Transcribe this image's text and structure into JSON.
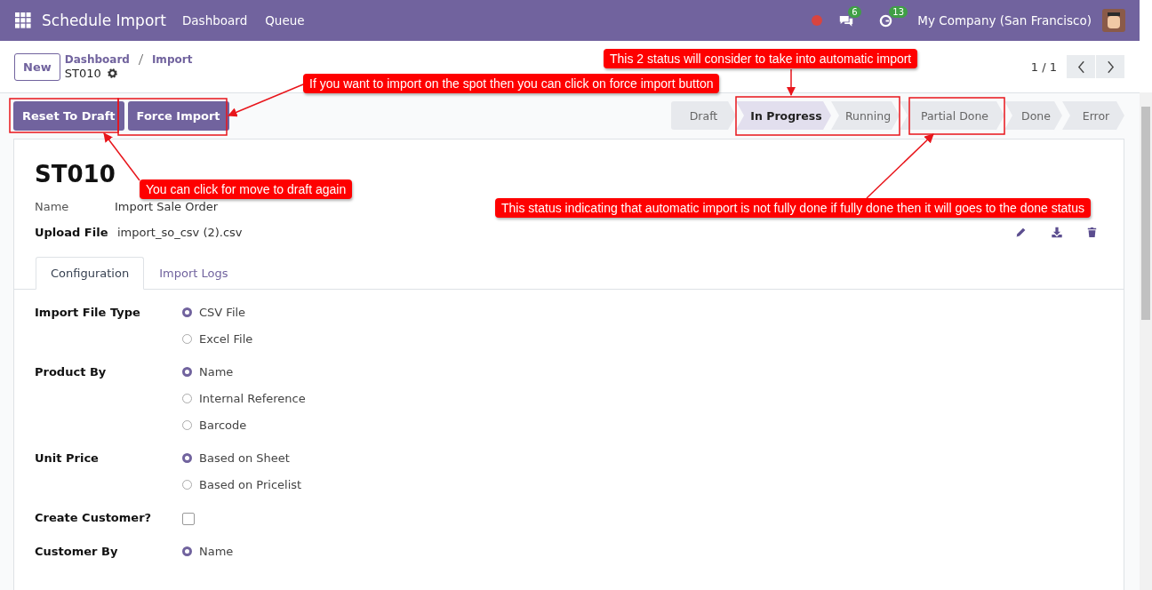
{
  "navbar": {
    "app_name": "Schedule Import",
    "menu": [
      "Dashboard",
      "Queue"
    ],
    "chat_count": "6",
    "activity_count": "13",
    "company": "My Company (San Francisco)"
  },
  "control_panel": {
    "new_button": "New",
    "breadcrumbs": [
      "Dashboard",
      "Import"
    ],
    "record": "ST010",
    "pager": "1 / 1"
  },
  "actions": [
    "Reset To Draft",
    "Force Import"
  ],
  "statusbar": [
    {
      "label": "Draft",
      "selected": false
    },
    {
      "label": "In Progress",
      "selected": true
    },
    {
      "label": "Running",
      "selected": false
    },
    {
      "label": "Partial Done",
      "selected": false
    },
    {
      "label": "Done",
      "selected": false
    },
    {
      "label": "Error",
      "selected": false
    }
  ],
  "form": {
    "title": "ST010",
    "name_label": "Name",
    "name_value": "Import Sale Order",
    "file_label": "Upload File",
    "file_value": "import_so_csv (2).csv",
    "tabs": [
      {
        "label": "Configuration",
        "selected": true
      },
      {
        "label": "Import Logs",
        "selected": false
      }
    ],
    "fields": [
      {
        "label": "Import File Type",
        "kind": "radio",
        "options": [
          {
            "label": "CSV File",
            "selected": true
          },
          {
            "label": "Excel File",
            "selected": false
          }
        ]
      },
      {
        "label": "Product By",
        "kind": "radio",
        "options": [
          {
            "label": "Name",
            "selected": true
          },
          {
            "label": "Internal Reference",
            "selected": false
          },
          {
            "label": "Barcode",
            "selected": false
          }
        ]
      },
      {
        "label": "Unit Price",
        "kind": "radio",
        "options": [
          {
            "label": "Based on Sheet",
            "selected": true
          },
          {
            "label": "Based on Pricelist",
            "selected": false
          }
        ]
      },
      {
        "label": "Create Customer?",
        "kind": "checkbox",
        "checked": false
      },
      {
        "label": "Customer By",
        "kind": "radio",
        "options": [
          {
            "label": "Name",
            "selected": true
          }
        ]
      }
    ]
  },
  "annotations": [
    {
      "text": "If you want to import on the spot then you can click on force import button"
    },
    {
      "text": "This 2 status will consider to take into automatic import"
    },
    {
      "text": "You can click for move to draft again"
    },
    {
      "text": "This status indicating that automatic import is not fully done if fully done then it will goes to the done status"
    }
  ]
}
